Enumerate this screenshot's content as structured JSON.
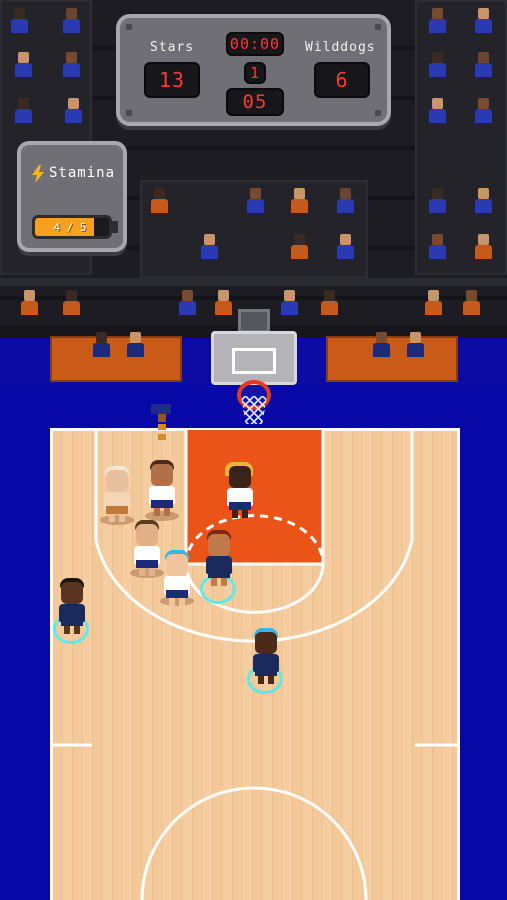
{
  "scoreboard": {
    "home_name": "Stars",
    "home_score": "13",
    "away_name": "Wilddogs",
    "away_score": "6",
    "clock": "00:00",
    "period": "1",
    "shot_clock": "05"
  },
  "stamina": {
    "label": "Stamina",
    "icon": "lightning-bolt-icon",
    "current": 4,
    "max": 5,
    "text": "4 / 5",
    "fill_fraction": 0.8
  },
  "colors": {
    "court_wood": "#f4c99a",
    "paint": "#ea5418",
    "apron_blue": "#0808a6",
    "led_red": "#ff3737",
    "selection_ring": "#5fe9e9",
    "stamina_fill": "#f5a01f"
  }
}
